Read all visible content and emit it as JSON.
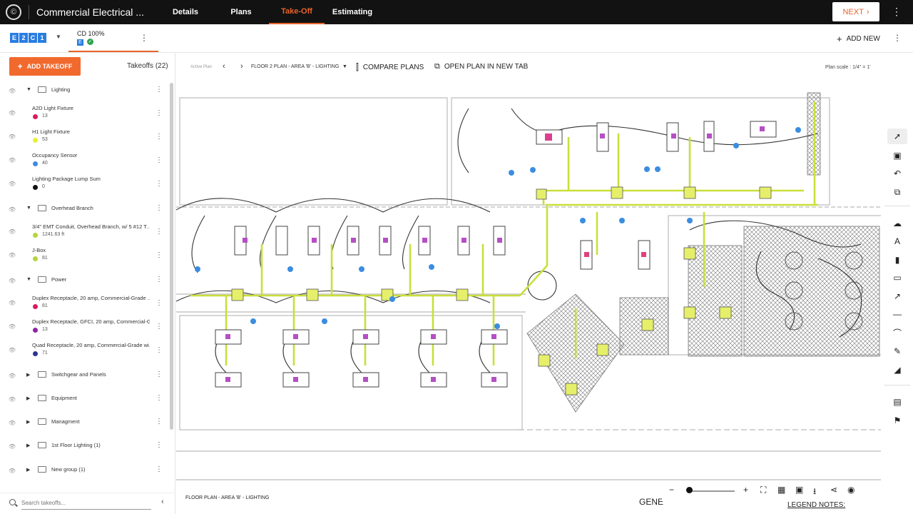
{
  "app": {
    "project_title": "Commercial Electrical ...",
    "nav_tabs": [
      {
        "label": "Details"
      },
      {
        "label": "Plans"
      },
      {
        "label": "Take-Off"
      },
      {
        "label": "Estimating"
      }
    ],
    "active_tab": "Take-Off",
    "next_label": "NEXT",
    "accent_color": "#e8632b",
    "brand_color": "#2a7de1"
  },
  "subbar": {
    "brand_letters": [
      "E",
      "2",
      "C",
      "1"
    ],
    "cd_label": "CD 100%",
    "cd_badge": "E",
    "add_new_label": "ADD NEW"
  },
  "sidebar": {
    "add_takeoff_label": "ADD TAKEOFF",
    "takeoffs_count_label": "Takeoffs (22)",
    "groups": [
      {
        "name": "Lighting",
        "expanded": true,
        "items": [
          {
            "name": "A2D Light Fixture",
            "qty": "13",
            "color": "#d81b60"
          },
          {
            "name": "H1 Light Fixture",
            "qty": "53",
            "color": "#e8ef3a"
          },
          {
            "name": "Occupancy Sensor",
            "qty": "40",
            "color": "#3b8de0"
          },
          {
            "name": "Lighting Package Lump Sum",
            "qty": "0",
            "color": "#111111"
          }
        ]
      },
      {
        "name": "Overhead Branch",
        "expanded": true,
        "items": [
          {
            "name": "3/4\" EMT Conduit, Overhead Branch, w/ 5 #12 T...",
            "qty": "1241.63 ft",
            "color": "#b5d63a"
          },
          {
            "name": "J-Box",
            "qty": "81",
            "color": "#b5d63a"
          }
        ]
      },
      {
        "name": "Power",
        "expanded": true,
        "items": [
          {
            "name": "Duplex Receptacle, 20 amp, Commercial-Grade ...",
            "qty": "81",
            "color": "#d81b60"
          },
          {
            "name": "Duplex Receptacle, GFCI, 20 amp, Commercial-G...",
            "qty": "13",
            "color": "#8e24aa"
          },
          {
            "name": "Quad Receptacle, 20 amp, Commercial-Grade wi...",
            "qty": "71",
            "color": "#283593"
          }
        ]
      },
      {
        "name": "Switchgear and Panels",
        "expanded": false,
        "items": []
      },
      {
        "name": "Equipment",
        "expanded": false,
        "items": []
      },
      {
        "name": "Managment",
        "expanded": false,
        "items": []
      },
      {
        "name": "1st Floor Lighting (1)",
        "expanded": false,
        "items": []
      },
      {
        "name": "New group (1)",
        "expanded": false,
        "items": []
      }
    ],
    "search_placeholder": "Search takeoffs..."
  },
  "plan_toolbar": {
    "active_plan_label": "Active Plan",
    "plan_name": "FLOOR 2 PLAN - AREA 'B' - LIGHTING",
    "compare_label": "COMPARE PLANS",
    "open_tab_label": "OPEN PLAN IN NEW TAB",
    "plan_scale": "Plan scale : 1/4\" = 1'"
  },
  "drawing": {
    "title_block": "FLOOR PLAN - AREA 'B' - LIGHTING",
    "general_label": "GENE",
    "legend_label": "LEGEND NOTES:"
  }
}
